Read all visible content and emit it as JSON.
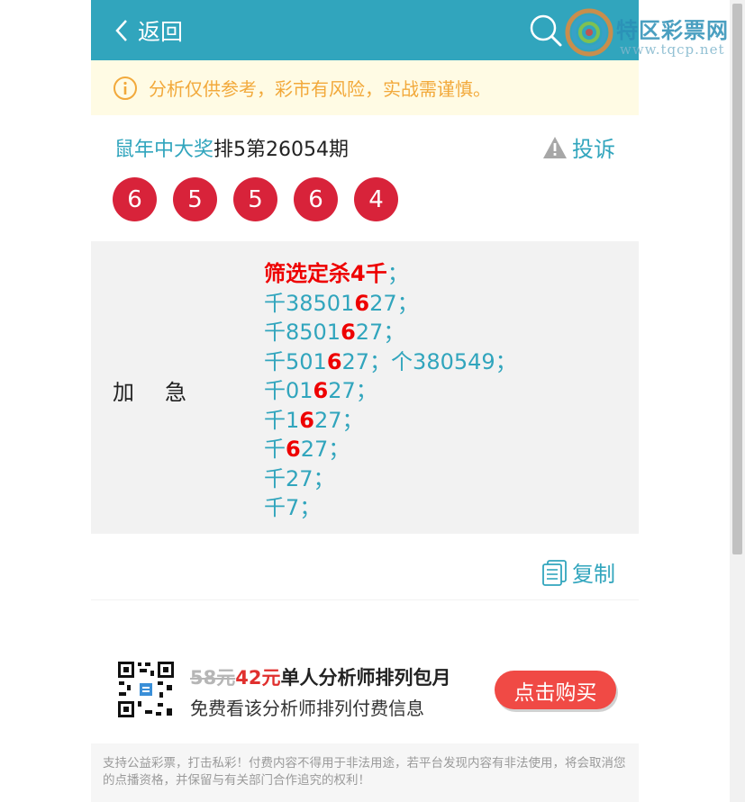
{
  "header": {
    "back_label": "返回",
    "search_icon": "search-icon",
    "brand_color": "#31a5bd"
  },
  "logo": {
    "text": "特区彩票网",
    "url": "www.tqcp.net"
  },
  "notice": {
    "icon": "info-icon",
    "text": "分析仅供参考，彩市有风险，实战需谨慎。"
  },
  "post": {
    "author": "鼠年中大奖",
    "issue": "排5第26054期",
    "report_label": "投诉",
    "report_icon": "warning-icon",
    "balls": [
      "6",
      "5",
      "5",
      "6",
      "4"
    ],
    "ball_color": "#d8233a"
  },
  "content": {
    "tag": "加急",
    "lines": [
      [
        {
          "t": "筛选定杀4千",
          "hl": true
        },
        {
          "t": "；"
        }
      ],
      [
        {
          "t": "千38501"
        },
        {
          "t": "6",
          "hl": true
        },
        {
          "t": "27；"
        }
      ],
      [
        {
          "t": "千8501"
        },
        {
          "t": "6",
          "hl": true
        },
        {
          "t": "27；"
        }
      ],
      [
        {
          "t": "千501"
        },
        {
          "t": "6",
          "hl": true
        },
        {
          "t": "27；个380549；"
        }
      ],
      [
        {
          "t": "千01"
        },
        {
          "t": "6",
          "hl": true
        },
        {
          "t": "27；"
        }
      ],
      [
        {
          "t": "千1"
        },
        {
          "t": "6",
          "hl": true
        },
        {
          "t": "27；"
        }
      ],
      [
        {
          "t": "千"
        },
        {
          "t": "6",
          "hl": true
        },
        {
          "t": "27；"
        }
      ],
      [
        {
          "t": "千27；"
        }
      ],
      [
        {
          "t": "千7；"
        }
      ]
    ]
  },
  "copy": {
    "label": "复制",
    "icon": "copy-icon"
  },
  "promo": {
    "old_price": "58元",
    "new_price": "42元",
    "title": "单人分析师排列包月",
    "subtitle": "免费看该分析师排列付费信息",
    "buy_label": "点击购买",
    "qr_icon": "qr-code-icon"
  },
  "disclaimer": "支持公益彩票，打击私彩！付费内容不得用于非法用途，若平台发现内容有非法使用，将会取消您的点播资格，并保留与有关部门合作追究的权利！"
}
